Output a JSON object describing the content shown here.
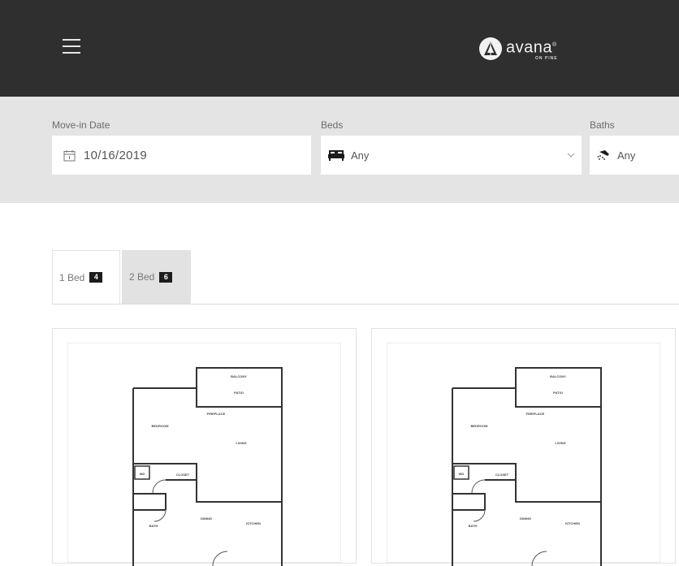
{
  "header": {
    "menu_icon": "hamburger-menu-icon",
    "logo_text": "avana",
    "logo_mark": "®",
    "logo_sub": "ON PINE",
    "bg_color": "#2f2f2f"
  },
  "filters": {
    "move_in": {
      "label": "Move-in Date",
      "value": "10/16/2019",
      "icon": "calendar-icon"
    },
    "beds": {
      "label": "Beds",
      "value": "Any",
      "icon": "bed-icon"
    },
    "baths": {
      "label": "Baths",
      "value": "Any",
      "icon": "shower-icon"
    }
  },
  "tabs": [
    {
      "label": "1 Bed",
      "count": "4",
      "active": true
    },
    {
      "label": "2 Bed",
      "count": "6",
      "active": false
    }
  ],
  "floorplan_labels": {
    "balcony": "BALCONY",
    "patio": "PATIO",
    "fireplace": "FIREPLACE",
    "bedroom": "BEDROOM",
    "living": "LIVING",
    "wd": "WD",
    "closet": "CLOSET",
    "bath": "BATH",
    "dining": "DINING",
    "kitchen": "KITCHEN"
  }
}
